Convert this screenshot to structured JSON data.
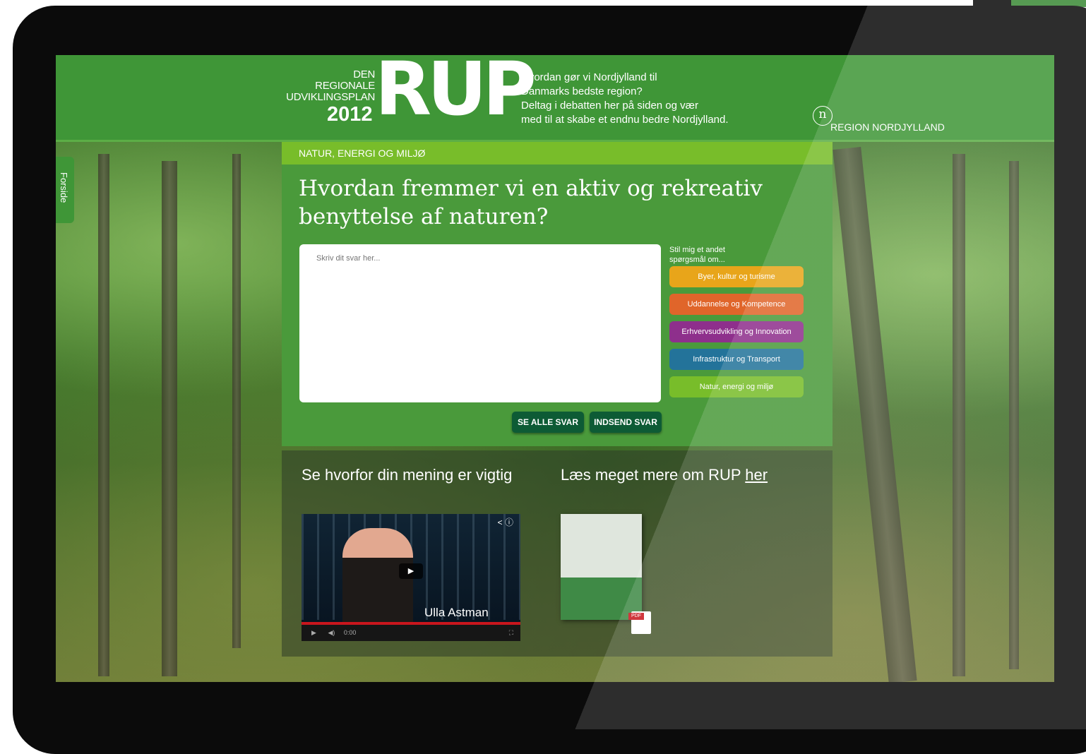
{
  "header": {
    "logo_line1": "DEN",
    "logo_line2": "REGIONALE",
    "logo_line3": "UDVIKLINGSPLAN",
    "logo_year": "2012",
    "logo_rup": "RUP",
    "tagline": [
      "Hvordan gør vi Nordjylland til",
      "Danmarks bedste region?",
      "Deltag i debatten her på siden og vær",
      "med til at skabe et endnu bedre Nordjylland."
    ],
    "region_mark": "n",
    "region_name": "REGION NORDJYLLAND"
  },
  "side_tab": {
    "label": "Forside"
  },
  "main": {
    "category": "NATUR, ENERGI OG MILJØ",
    "question": "Hvordan fremmer vi en aktiv og rekreativ benyttelse af naturen?",
    "answer_placeholder": "Skriv dit svar her...",
    "ask_label": "Stil mig et andet spørgsmål om...",
    "topics": [
      {
        "label": "Byer, kultur og turisme",
        "color": "#e8a51a"
      },
      {
        "label": "Uddannelse og Kompetence",
        "color": "#e0652a"
      },
      {
        "label": "Erhvervsudvikling og Innovation",
        "color": "#8e2f8c"
      },
      {
        "label": "Infrastruktur og Transport",
        "color": "#23739a"
      },
      {
        "label": "Natur, energi og miljø",
        "color": "#78bd2a"
      }
    ],
    "see_all_button": "SE ALLE SVAR",
    "submit_button": "INDSEND SVAR"
  },
  "lower": {
    "video_heading": "Se hvorfor din mening er vigtig",
    "read_heading": "Læs meget mere om RUP",
    "read_link": "her",
    "video_person_name": "Ulla Astman",
    "video_time": "0:00",
    "doc_badge": "PDF"
  }
}
